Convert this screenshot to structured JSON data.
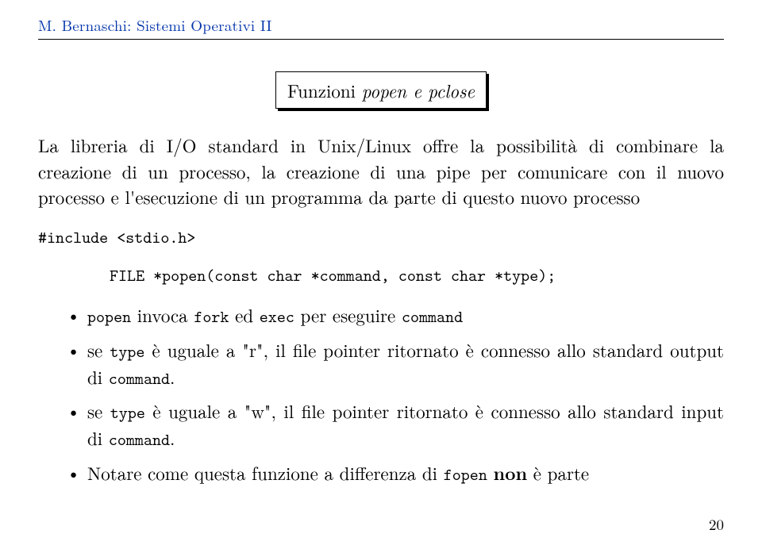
{
  "header": "M. Bernaschi: Sistemi Operativi II",
  "title_plain": "Funzioni ",
  "title_ital": "popen e pclose",
  "para1": "La libreria di I/O standard in Unix/Linux offre la possibilità di combinare la creazione di un processo, la creazione di una pipe per comunicare con il nuovo processo e l'esecuzione di un programma da parte di questo nuovo processo",
  "include_line": "#include <stdio.h>",
  "proto_line": "FILE *popen(const char *command, const char *type);",
  "bullets": {
    "b1a": "popen",
    "b1b": " invoca ",
    "b1c": "fork",
    "b1d": " ed ",
    "b1e": "exec",
    "b1f": " per eseguire ",
    "b1g": "command",
    "b2a": "se ",
    "b2b": "type",
    "b2c": " è uguale a \"r\", il file pointer ritornato è connesso allo standard output di ",
    "b2d": "command",
    "b2e": ".",
    "b3a": "se ",
    "b3b": "type",
    "b3c": " è uguale a \"w\", il file pointer ritornato è connesso allo standard input di ",
    "b3d": "command",
    "b3e": ".",
    "b4a": "Notare come questa funzione a differenza di ",
    "b4b": "fopen",
    "b4c": " ",
    "b4d": "non",
    "b4e": " è parte"
  },
  "page_number": "20"
}
